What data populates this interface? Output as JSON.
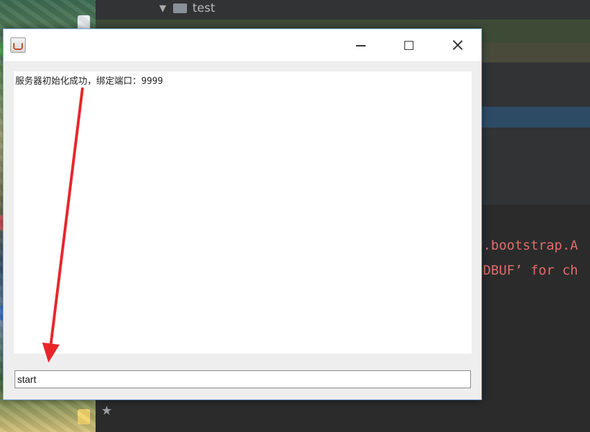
{
  "ide": {
    "tree_folder": "test",
    "console_line_1": "y.bootstrap.A",
    "console_line_2": "NDBUF’ for ch"
  },
  "window": {
    "log_text": "服务器初始化成功，绑定端口：9999",
    "input_value": "start"
  },
  "colors": {
    "annotation_arrow": "#e8262a",
    "console_text": "#e06c6c",
    "window_border": "#7aa6d6"
  },
  "icons": {
    "app_icon": "java-cup-icon",
    "minimize": "minimize-icon",
    "maximize": "maximize-icon",
    "close": "close-icon"
  }
}
